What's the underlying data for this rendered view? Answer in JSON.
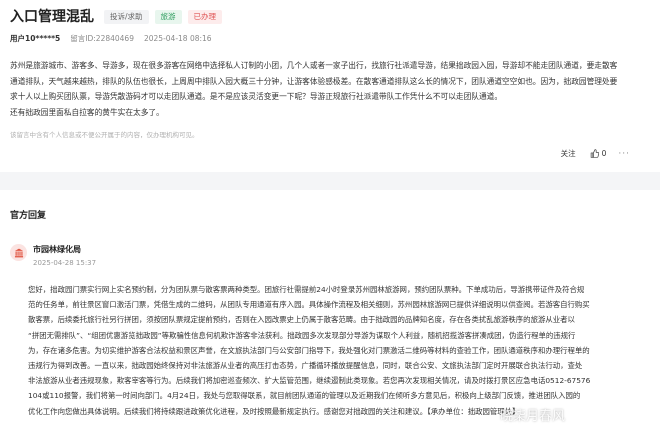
{
  "post": {
    "title": "入口管理混乱",
    "tags": [
      "投诉/求助",
      "旅游",
      "已办理"
    ],
    "user": "用户10*****5",
    "message_id": "留言ID:22840469",
    "date": "2025-04-18 08:16",
    "content_lines": [
      "苏州是旅游城市、游客多、导游多，现在很多游客在网络中选择私人订制的小团，几个人或者一家子出行，找旅行社派遣导游，结果拙政园入园，导游却不能走团队通道，要走散客",
      "通道排队，天气越来越热，排队的队伍也很长，上周周中排队入园大概三十分钟，让游客体验感极差。在散客通道排队这么长的情况下，团队通道空空如也。因为，拙政园管理处要",
      "求十人以上购买团队票，导游凭散游码才可以走团队通道。是不是应该灵活变更一下呢？导游正规旅行社派遣带队工作凭什么不可以走团队通道。",
      "还有拙政园里面私自拉客的黄牛实在太多了。"
    ],
    "notice": "该留言中含有个人信息或不便公开属于的内容，仅办理机构可见。"
  },
  "actions": {
    "follow_label": "关注",
    "like_count": "0",
    "more_label": "···"
  },
  "reply": {
    "header": "官方回复",
    "org_name": "市园林绿化局",
    "time": "2025-04-28 15:37",
    "body_lines": [
      "您好，拙政园门票实行网上实名预约制，分为团队票与散客票两种类型。团旅行社需提前24小时登录苏州园林旅游网，预约团队票种。下单成功后，导游携带证件及符合规",
      "范的任务单，前往景区窗口激活门票，凭借生成的二维码，从团队专用通道有序入园。具体操作流程及相关细则，苏州园林旅游网已提供详细说明以供查阅。若游客自行购买",
      "散客票，后续委托旅行社另行拼团，须按团队票规定提前预约，否则在入园改票史上仍属于散客范畴。由于拙政园的品牌知名度，存在各类扰乱旅游秩序的旅游从业者以",
      "“拼团无需排队”、“组团优惠游览拙政园”等欺骗性信息何机欺诈游客非法获利。拙政园多次发现部分导游为谋取个人利益，随机招揽游客拼凑成团，伪造行程单的违规行",
      "为，存在诸多危害。为切实维护游客合法权益和景区声誉，在文旅执法部门与公安部门指导下，我处强化对门票激活二维码等材料的查验工作，团队通道秩序和办理行程单的",
      "违规行为得到改善。一直以来，拙政园始终保持对非法旅游从业者的高压打击态势，广播循环播放提醒信息，同时，联合公安、文旅执法部门定时开展联合执法行动，查处",
      "非法旅游从业者违规现象，欺客宰客等行为。后续我们将加密巡查频次、扩大监管范围，继续遏制此类现象。若您再次发现相关情况，请及时拨打景区应急电话0512-67576",
      "104或110报警，我们将第一时间向部门。4月24日，我处与您取得联系，就目前团队通道的管理以及近期我们在倾听多方意见后，积极向上级部门反馈，推进团队入园的",
      "优化工作向您做出具体说明。后续我们将持续跟进政策优化进程，及时按照最新规定执行。感谢您对拙政园的关注和建议。【承办单位：拙政园管理处】"
    ]
  },
  "watermark": "晓柒月春风"
}
